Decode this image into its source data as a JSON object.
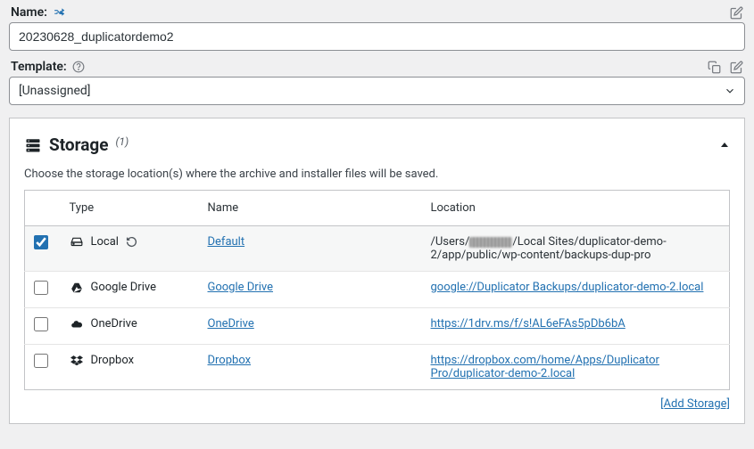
{
  "name": {
    "label": "Name:",
    "value": "20230628_duplicatordemo2"
  },
  "template": {
    "label": "Template:",
    "selected": "[Unassigned]"
  },
  "storage": {
    "title": "Storage",
    "count_label": "(1)",
    "description": "Choose the storage location(s) where the archive and installer files will be saved.",
    "columns": {
      "type": "Type",
      "name": "Name",
      "location": "Location"
    },
    "rows": [
      {
        "checked": true,
        "icon": "hdd-icon",
        "type_label": "Local",
        "has_refresh": true,
        "name_label": "Default",
        "location_is_link": false,
        "location_prefix": "/Users/",
        "location_suffix": "/Local Sites/duplicator-demo-2/app/public/wp-content/backups-dup-pro"
      },
      {
        "checked": false,
        "icon": "gdrive-icon",
        "type_label": "Google Drive",
        "name_label": "Google Drive",
        "location_is_link": true,
        "location_text": "google://Duplicator Backups/duplicator-demo-2.local"
      },
      {
        "checked": false,
        "icon": "cloud-icon",
        "type_label": "OneDrive",
        "name_label": "OneDrive",
        "location_is_link": true,
        "location_text": "https://1drv.ms/f/s!AL6eFAs5pDb6bA"
      },
      {
        "checked": false,
        "icon": "dropbox-icon",
        "type_label": "Dropbox",
        "name_label": "Dropbox",
        "location_is_link": true,
        "location_text": "https://dropbox.com/home/Apps/Duplicator Pro/duplicator-demo-2.local"
      }
    ],
    "add_label": "[Add Storage]"
  }
}
